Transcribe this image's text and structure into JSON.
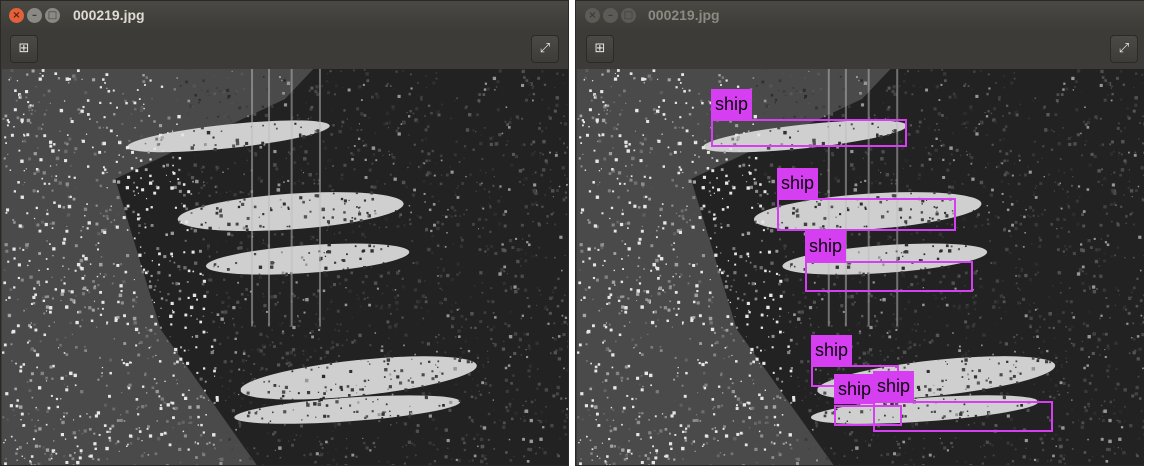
{
  "left_window": {
    "title": "000219.jpg",
    "toolbar": {
      "add_icon": "plus-square-icon",
      "fullscreen_icon": "expand-icon"
    }
  },
  "right_window": {
    "title": "000219.jpg",
    "toolbar": {
      "add_icon": "plus-square-icon",
      "fullscreen_icon": "expand-icon"
    },
    "detections": [
      {
        "label": "ship"
      },
      {
        "label": "ship"
      },
      {
        "label": "ship"
      },
      {
        "label": "ship"
      },
      {
        "label": "ship"
      },
      {
        "label": "ship"
      }
    ]
  },
  "colors": {
    "detection": "#d63ff1",
    "titlebar": "#3c3b37",
    "close_button": "#e2603a"
  }
}
